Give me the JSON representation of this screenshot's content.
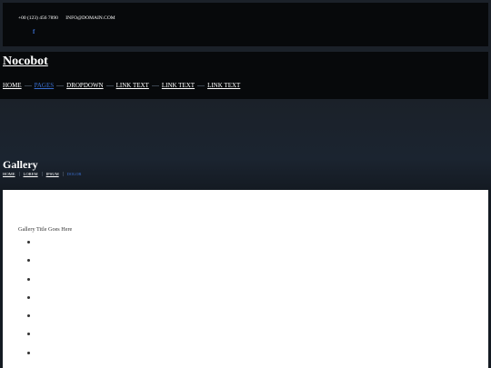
{
  "topbar": {
    "phone": "+00 (123) 456 7890",
    "email": "INFO@DOMAIN.COM",
    "social_icon": "f"
  },
  "navbar": {
    "brand": "Nocobot",
    "menu": [
      {
        "label": "HOME",
        "active": false
      },
      {
        "label": "PAGES",
        "active": true
      },
      {
        "label": "DROPDOWN",
        "active": false
      },
      {
        "label": "LINK TEXT",
        "active": false
      },
      {
        "label": "LINK TEXT",
        "active": false
      },
      {
        "label": "LINK TEXT",
        "active": false
      }
    ]
  },
  "header": {
    "title": "Gallery",
    "breadcrumb": [
      {
        "label": "HOME",
        "current": false
      },
      {
        "label": "LOREM",
        "current": false
      },
      {
        "label": "IPSUM",
        "current": false
      },
      {
        "label": "DOLOR",
        "current": true
      }
    ]
  },
  "main": {
    "gallery_title": "Gallery Title Goes Here",
    "gallery_items": 7
  },
  "colors": {
    "accent": "#3a6fd0",
    "bar_background": "#07090b",
    "page_background": "#1b2129"
  }
}
